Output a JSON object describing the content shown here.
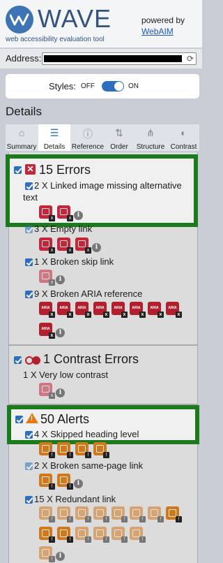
{
  "header": {
    "logo_text": "WAVE",
    "logo_subtitle": "web accessibility evaluation tool",
    "powered_by": "powered by",
    "powered_link": "WebAIM"
  },
  "address": {
    "label": "Address:"
  },
  "styles": {
    "label": "Styles:",
    "off": "OFF",
    "on": "ON",
    "state": "on"
  },
  "details_heading": "Details",
  "tabs": [
    {
      "label": "Summary",
      "icon": "home-icon",
      "active": false
    },
    {
      "label": "Details",
      "icon": "list-icon",
      "active": true
    },
    {
      "label": "Reference",
      "icon": "info-icon",
      "active": false
    },
    {
      "label": "Order",
      "icon": "order-icon",
      "active": false
    },
    {
      "label": "Structure",
      "icon": "structure-icon",
      "active": false
    },
    {
      "label": "Contrast",
      "icon": "contrast-icon",
      "active": false
    }
  ],
  "errors": {
    "title": "15 Errors",
    "items": [
      {
        "label": "2 X Linked image missing alternative",
        "label_line2": "text",
        "count": 2
      },
      {
        "label": "3 X Empty link",
        "count": 3
      },
      {
        "label": "1 X Broken skip link",
        "count": 1
      },
      {
        "label": "9 X Broken ARIA reference",
        "count": 9,
        "icon_text": "ARIA"
      }
    ]
  },
  "contrast": {
    "title": "1 Contrast Errors",
    "items": [
      {
        "label": "1 X Very low contrast",
        "count": 1
      }
    ]
  },
  "alerts": {
    "title": "50 Alerts",
    "items": [
      {
        "label": "4 X Skipped heading level",
        "count": 4
      },
      {
        "label": "2 X Broken same-page link",
        "count": 2
      },
      {
        "label": "15 X Redundant link",
        "count": 15
      }
    ]
  },
  "colors": {
    "error": "#c2263b",
    "alert": "#d1781d",
    "highlight": "#1b7a1b",
    "accent": "#2e6fbd"
  }
}
